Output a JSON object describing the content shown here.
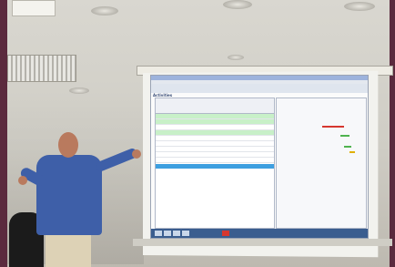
{
  "scene": {
    "colors": {
      "wall": "#d4d2ca",
      "frame": "#5b2a3e",
      "shirt": "#3e5fa8",
      "projected_title_bar": "#9db3dc",
      "selected_row": "#3d9fe0",
      "taskbar": "#3a5d8f"
    }
  },
  "projection": {
    "panel_label": "Activities"
  }
}
